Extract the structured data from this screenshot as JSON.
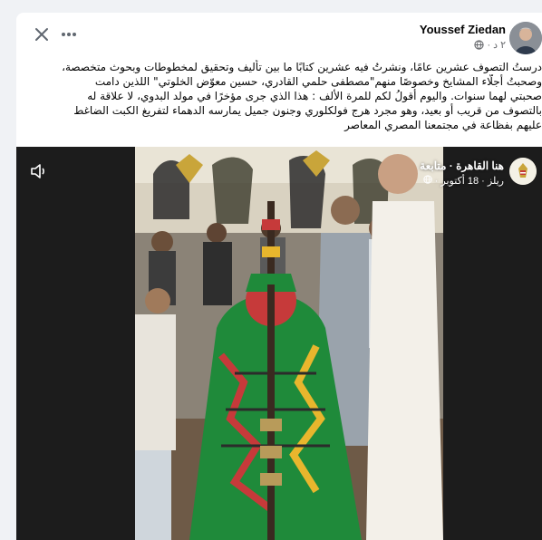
{
  "post": {
    "author": "Youssef Ziedan",
    "time": "٢ د",
    "privacy_icon": "globe-icon",
    "text_lines": [
      "درستُ التصوف عشرين عامًا، ونشرتُ فيه عشرين كتابًا ما بين تأليف وتحقيق لمخطوطات وبحوث متخصصة،",
      "وصحبتُ أجلّاء المشايخ وخصوصًا منهم\"مصطفى حلمي القادري، حسين معوّض الخلوتي\" اللذين دامت",
      "صحبتي لهما سنوات. واليوم أقولُ لكم للمرة الألف : هذا الذي جرى مؤخرًا في مولد البدوي، لا علاقة له",
      "بالتصوف من قريب أو بعيد، وهو مجرد هرج فولكلوري وجنون جميل يمارسه الدهماء لتفريغ الكبت الضاغط",
      "عليهم بفظاعة في مجتمعنا المصري المعاصر"
    ]
  },
  "shared_reel": {
    "page_name": "هنا القاهرة · متابعة",
    "sub": "ريلز · 18 أكتوبر ·",
    "privacy_icon": "globe-icon"
  },
  "colors": {
    "accent_green": "#1f8a3a",
    "card_bg": "#ffffff",
    "page_bg": "#f0f2f5"
  }
}
